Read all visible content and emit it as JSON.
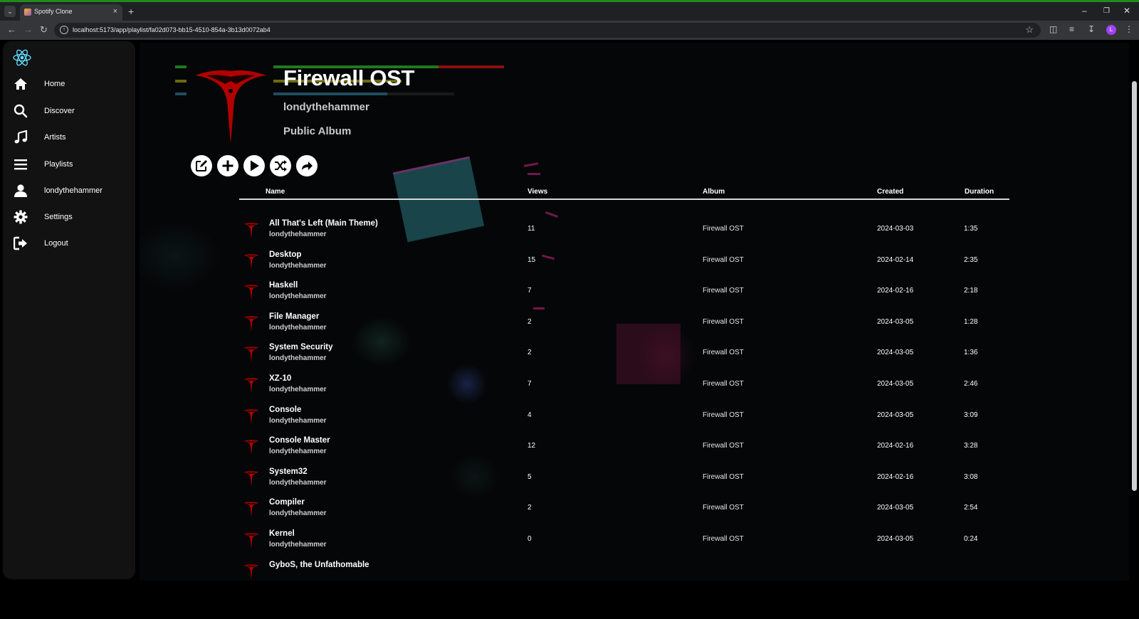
{
  "browser": {
    "tab_title": "Spotify Clone",
    "url": "localhost:5173/app/playlist/fa02d073-bb15-4510-854a-3b13d0072ab4",
    "profile_initial": "L"
  },
  "sidebar": {
    "items": [
      {
        "label": "Home",
        "icon": "home-icon"
      },
      {
        "label": "Discover",
        "icon": "search-icon"
      },
      {
        "label": "Artists",
        "icon": "music-note-icon"
      },
      {
        "label": "Playlists",
        "icon": "list-icon"
      },
      {
        "label": "londythehammer",
        "icon": "user-icon"
      },
      {
        "label": "Settings",
        "icon": "gear-icon"
      },
      {
        "label": "Logout",
        "icon": "logout-icon"
      }
    ]
  },
  "playlist": {
    "title": "Firewall OST",
    "owner": "londythehammer",
    "visibility": "Public Album",
    "actions": [
      "edit-icon",
      "add-icon",
      "play-icon",
      "shuffle-icon",
      "share-icon"
    ]
  },
  "table": {
    "headers": {
      "name": "Name",
      "views": "Views",
      "album": "Album",
      "created": "Created",
      "duration": "Duration"
    },
    "rows": [
      {
        "title": "All That's Left (Main Theme)",
        "artist": "londythehammer",
        "views": "11",
        "album": "Firewall OST",
        "created": "2024-03-03",
        "duration": "1:35"
      },
      {
        "title": "Desktop",
        "artist": "londythehammer",
        "views": "15",
        "album": "Firewall OST",
        "created": "2024-02-14",
        "duration": "2:35"
      },
      {
        "title": "Haskell",
        "artist": "londythehammer",
        "views": "7",
        "album": "Firewall OST",
        "created": "2024-02-16",
        "duration": "2:18"
      },
      {
        "title": "File Manager",
        "artist": "londythehammer",
        "views": "2",
        "album": "Firewall OST",
        "created": "2024-03-05",
        "duration": "1:28"
      },
      {
        "title": "System Security",
        "artist": "londythehammer",
        "views": "2",
        "album": "Firewall OST",
        "created": "2024-03-05",
        "duration": "1:36"
      },
      {
        "title": "XZ-10",
        "artist": "londythehammer",
        "views": "7",
        "album": "Firewall OST",
        "created": "2024-03-05",
        "duration": "2:46"
      },
      {
        "title": "Console",
        "artist": "londythehammer",
        "views": "4",
        "album": "Firewall OST",
        "created": "2024-03-05",
        "duration": "3:09"
      },
      {
        "title": "Console Master",
        "artist": "londythehammer",
        "views": "12",
        "album": "Firewall OST",
        "created": "2024-02-16",
        "duration": "3:28"
      },
      {
        "title": "System32",
        "artist": "londythehammer",
        "views": "5",
        "album": "Firewall OST",
        "created": "2024-02-16",
        "duration": "3:08"
      },
      {
        "title": "Compiler",
        "artist": "londythehammer",
        "views": "2",
        "album": "Firewall OST",
        "created": "2024-03-05",
        "duration": "2:54"
      },
      {
        "title": "Kernel",
        "artist": "londythehammer",
        "views": "0",
        "album": "Firewall OST",
        "created": "2024-03-05",
        "duration": "0:24"
      },
      {
        "title": "GyboS, the Unfathomable",
        "artist": "",
        "views": "",
        "album": "",
        "created": "",
        "duration": ""
      }
    ]
  },
  "colors": {
    "accent_red": "#b00000",
    "sidebar_bg": "#121212",
    "bg": "#000000"
  }
}
